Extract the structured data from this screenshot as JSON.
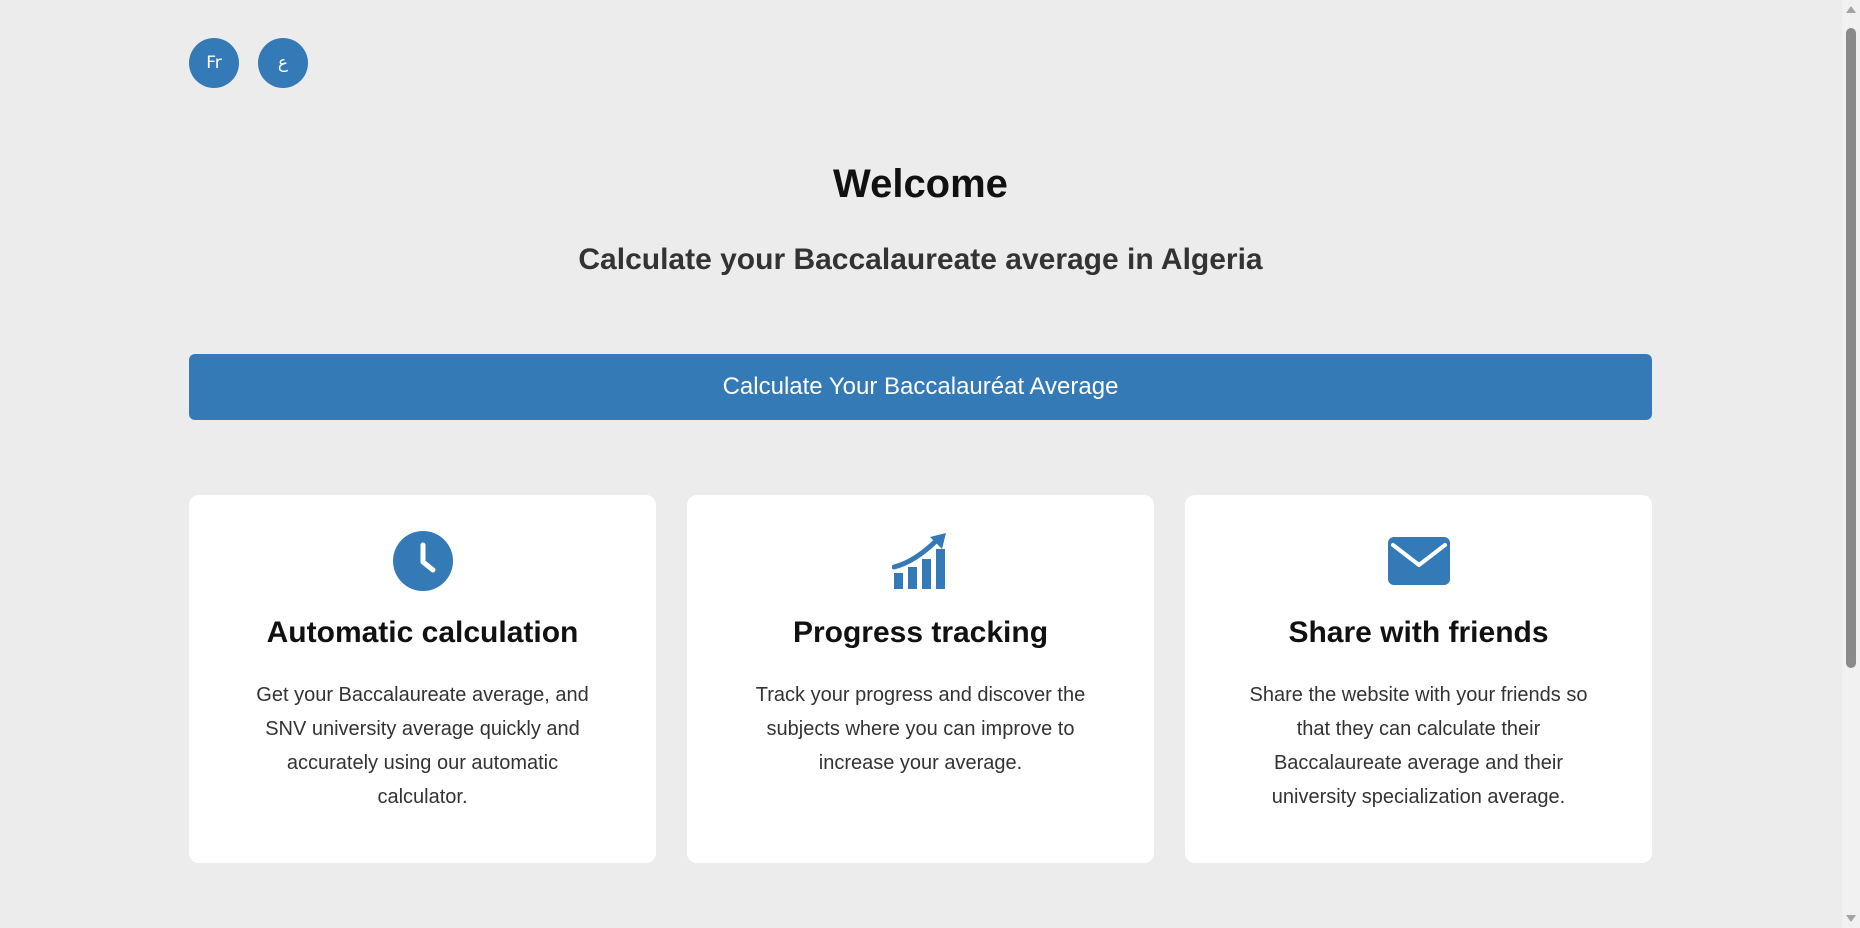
{
  "language_switcher": {
    "french_label": "Fr",
    "arabic_label": "ع"
  },
  "hero": {
    "title": "Welcome",
    "subtitle": "Calculate your Baccalaureate average in Algeria"
  },
  "cta": {
    "label": "Calculate Your Baccalauréat Average"
  },
  "features": [
    {
      "icon": "clock-icon",
      "title": "Automatic calculation",
      "text": "Get your Baccalaureate average, and SNV university average quickly and accurately using our automatic calculator."
    },
    {
      "icon": "growth-chart-icon",
      "title": "Progress tracking",
      "text": "Track your progress and discover the subjects where you can improve to increase your average."
    },
    {
      "icon": "envelope-icon",
      "title": "Share with friends",
      "text": "Share the website with your friends so that they can calculate their Baccalaureate average and their university specialization average."
    }
  ],
  "colors": {
    "accent": "#337ab7",
    "background": "#ececec",
    "card_background": "#ffffff"
  }
}
